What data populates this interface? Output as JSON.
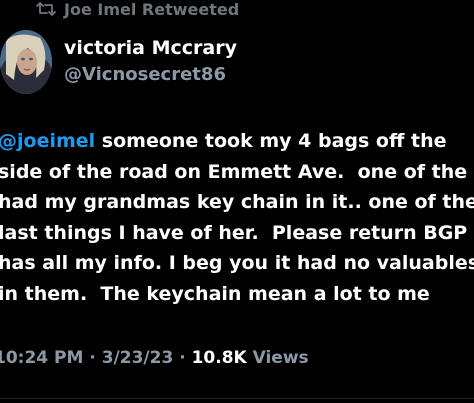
{
  "retweet": {
    "icon": "retweet-icon",
    "label": "Joe Imel Retweeted"
  },
  "author": {
    "display_name": "victoria Mccrary",
    "handle": "@Vicnosecret86",
    "avatar_icon": "avatar"
  },
  "tweet": {
    "mention": "@joeimel",
    "line1_rest": " someone took my 4 bags off the",
    "line2": "side of the road on Emmett Ave.  one of the",
    "line3": "had my grandmas key chain in it.. one of the",
    "line4": "last things I have of her.  Please return BGP",
    "line5": "has all my info. I beg you it had no valuables",
    "line6": "in them.  The keychain mean a lot to me"
  },
  "meta": {
    "time": "10:24 PM",
    "sep1": " · ",
    "date": "3/23/23",
    "sep2": " · ",
    "views_count": "10.8K",
    "views_label": " Views"
  },
  "colors": {
    "background": "#000000",
    "mention": "#1d9bf0",
    "secondary_text": "#8b98a5"
  }
}
